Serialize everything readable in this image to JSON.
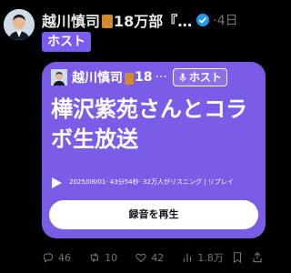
{
  "post": {
    "author_name": "越川慎司",
    "author_name_suffix": "18万部『…",
    "time": "·4日",
    "host_label": "ホスト"
  },
  "card": {
    "author_name": "越川慎司",
    "author_suffix": "18",
    "dots": "···",
    "host_label": "ホスト",
    "title": "樺沢紫苑さんとコラボ生放送",
    "meta": "2025/08/01· 43分54秒· 32万人がリスニング | リプレイ",
    "button_label": "録音を再生",
    "background_color": "#7b5ce7"
  },
  "actions": {
    "replies": "46",
    "reposts": "10",
    "likes": "42",
    "views": "1.8万"
  }
}
